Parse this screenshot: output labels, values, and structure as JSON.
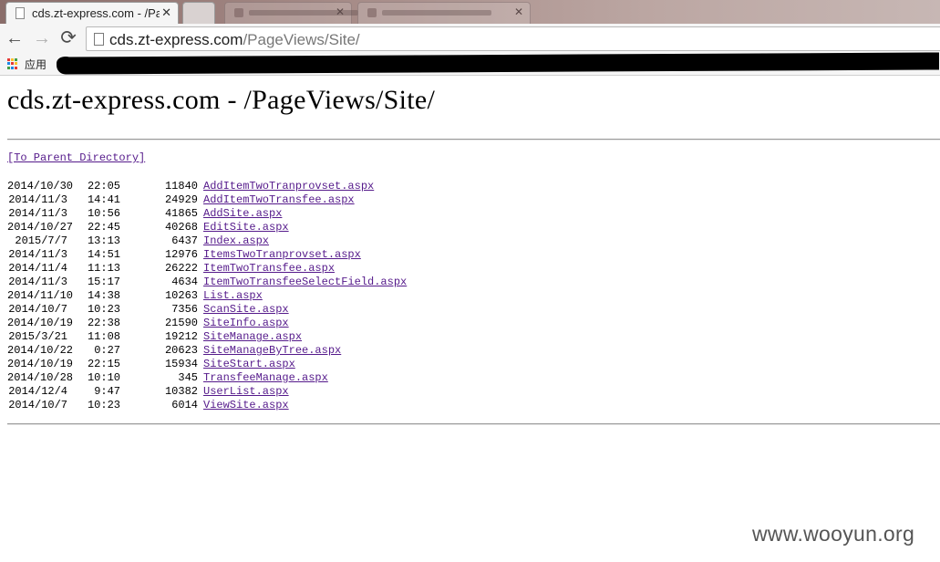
{
  "browser": {
    "tabs": [
      {
        "title": "cds.zt-express.com - /Pa",
        "close": "✕"
      },
      {
        "title": ""
      }
    ],
    "nav": {
      "back": "←",
      "forward": "→",
      "reload": "⟳"
    },
    "address": {
      "host": "cds.zt-express.com",
      "path": "/PageViews/Site/"
    },
    "bookmarks": {
      "apps_label": "应用"
    }
  },
  "page": {
    "title": "cds.zt-express.com - /PageViews/Site/",
    "parent_link": "[To Parent Directory]",
    "listing": [
      {
        "date": "2014/10/30",
        "time": "22:05",
        "size": "11840",
        "name": "AddItemTwoTranprovset.aspx"
      },
      {
        "date": "2014/11/3",
        "time": "14:41",
        "size": "24929",
        "name": "AddItemTwoTransfee.aspx"
      },
      {
        "date": "2014/11/3",
        "time": "10:56",
        "size": "41865",
        "name": "AddSite.aspx"
      },
      {
        "date": "2014/10/27",
        "time": "22:45",
        "size": "40268",
        "name": "EditSite.aspx"
      },
      {
        "date": "2015/7/7",
        "time": "13:13",
        "size": "6437",
        "name": "Index.aspx"
      },
      {
        "date": "2014/11/3",
        "time": "14:51",
        "size": "12976",
        "name": "ItemsTwoTranprovset.aspx"
      },
      {
        "date": "2014/11/4",
        "time": "11:13",
        "size": "26222",
        "name": "ItemTwoTransfee.aspx"
      },
      {
        "date": "2014/11/3",
        "time": "15:17",
        "size": "4634",
        "name": "ItemTwoTransfeeSelectField.aspx"
      },
      {
        "date": "2014/11/10",
        "time": "14:38",
        "size": "10263",
        "name": "List.aspx"
      },
      {
        "date": "2014/10/7",
        "time": "10:23",
        "size": "7356",
        "name": "ScanSite.aspx"
      },
      {
        "date": "2014/10/19",
        "time": "22:38",
        "size": "21590",
        "name": "SiteInfo.aspx"
      },
      {
        "date": "2015/3/21",
        "time": "11:08",
        "size": "19212",
        "name": "SiteManage.aspx"
      },
      {
        "date": "2014/10/22",
        "time": "0:27",
        "size": "20623",
        "name": "SiteManageByTree.aspx"
      },
      {
        "date": "2014/10/19",
        "time": "22:15",
        "size": "15934",
        "name": "SiteStart.aspx"
      },
      {
        "date": "2014/10/28",
        "time": "10:10",
        "size": "345",
        "name": "TransfeeManage.aspx"
      },
      {
        "date": "2014/12/4",
        "time": "9:47",
        "size": "10382",
        "name": "UserList.aspx"
      },
      {
        "date": "2014/10/7",
        "time": "10:23",
        "size": "6014",
        "name": "ViewSite.aspx"
      }
    ]
  },
  "watermark": "www.wooyun.org",
  "colors": {
    "link": "#551a8b",
    "chrome": "#f5f5f5",
    "tabstrip": "#a58a86"
  }
}
